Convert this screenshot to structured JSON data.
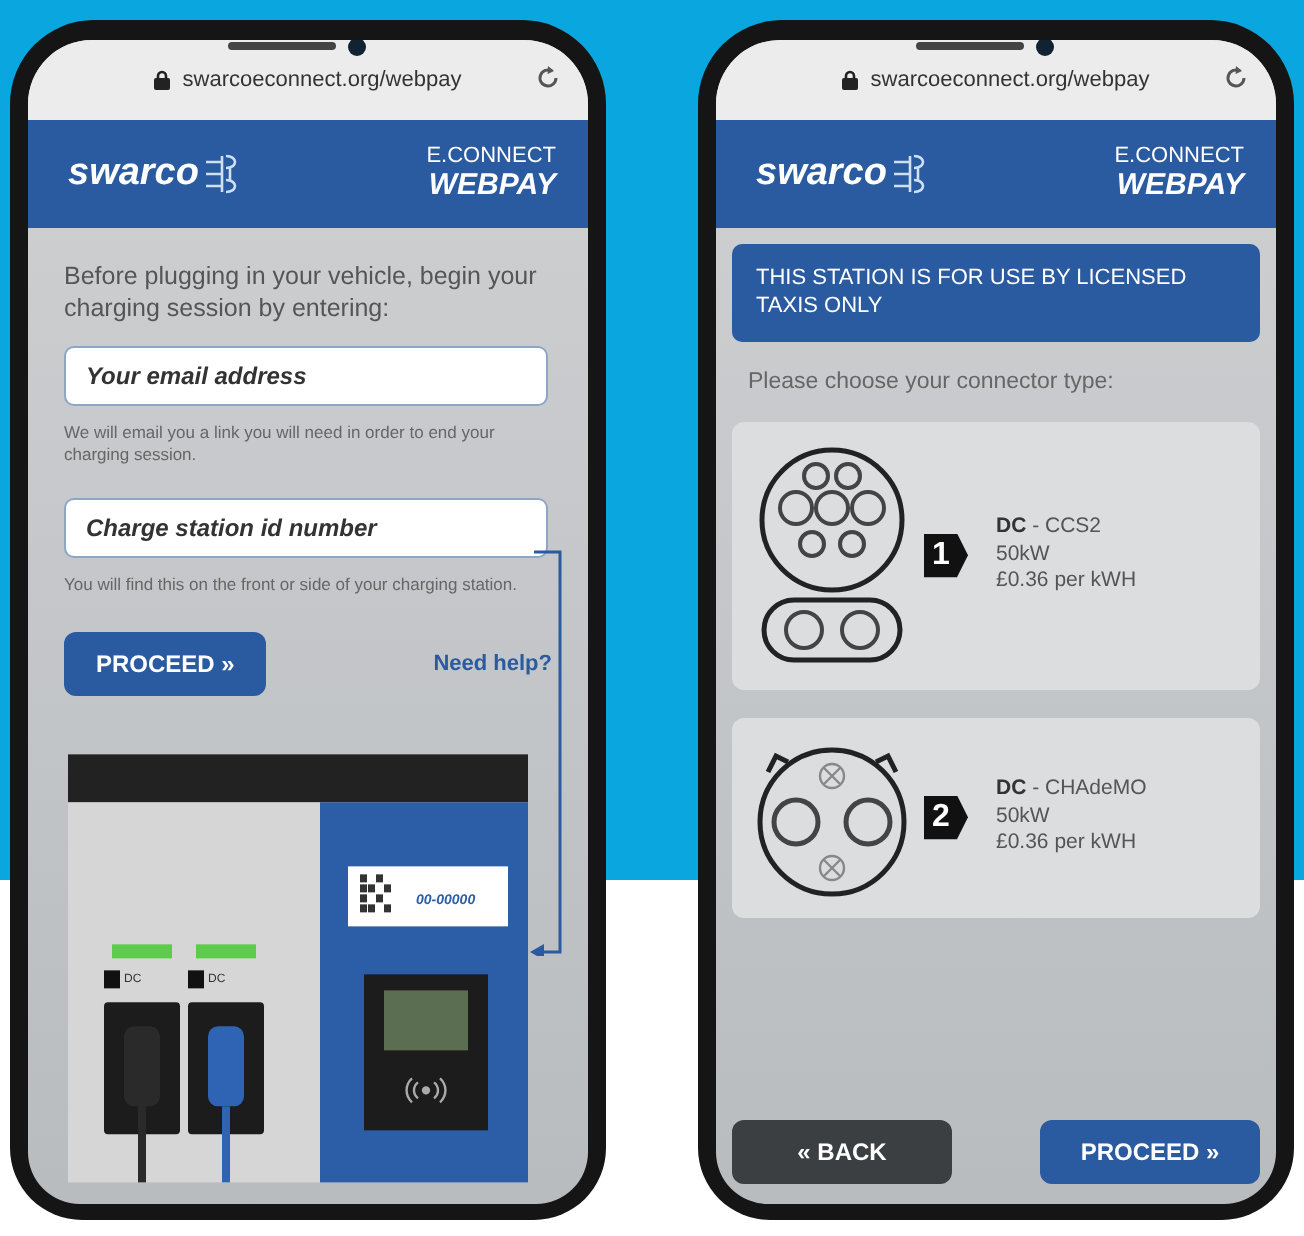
{
  "phones": [
    {
      "kind": "form",
      "url": "swarcoeconnect.org/webpay",
      "brand": "swarco",
      "product_top": "E.CONNECT",
      "product_bottom": "WEBPAY",
      "intro": "Before plugging in your vehicle, begin your charging session by entering:",
      "fields": [
        {
          "placeholder": "Your email address",
          "hint": "We will email you a link you will need in order to end your charging session."
        },
        {
          "placeholder": "Charge station id number",
          "hint": "You will find this on the front or side of your charging station."
        }
      ],
      "proceed": "PROCEED »",
      "help": "Need help?",
      "station": {
        "id_label": "00-00000",
        "sockets": [
          {
            "label": "DC",
            "color": "#2a2a2a"
          },
          {
            "label": "DC",
            "color": "#2f63b4"
          }
        ]
      }
    },
    {
      "kind": "connectors",
      "url": "swarcoeconnect.org/webpay",
      "brand": "swarco",
      "product_top": "E.CONNECT",
      "product_bottom": "WEBPAY",
      "notice": "THIS STATION IS FOR USE BY LICENSED TAXIS ONLY",
      "prompt": "Please choose your connector type:",
      "connectors": [
        {
          "kind": "ccs2",
          "number": "1",
          "type": "**DC** - CCS2",
          "power": "50kW",
          "price": "£0.36 per kWH"
        },
        {
          "kind": "chademo",
          "number": "2",
          "type": "**DC** - CHAdeMO",
          "power": "50kW",
          "price": "£0.36 per kWH"
        }
      ],
      "back": "« BACK",
      "proceed": "PROCEED »"
    }
  ]
}
